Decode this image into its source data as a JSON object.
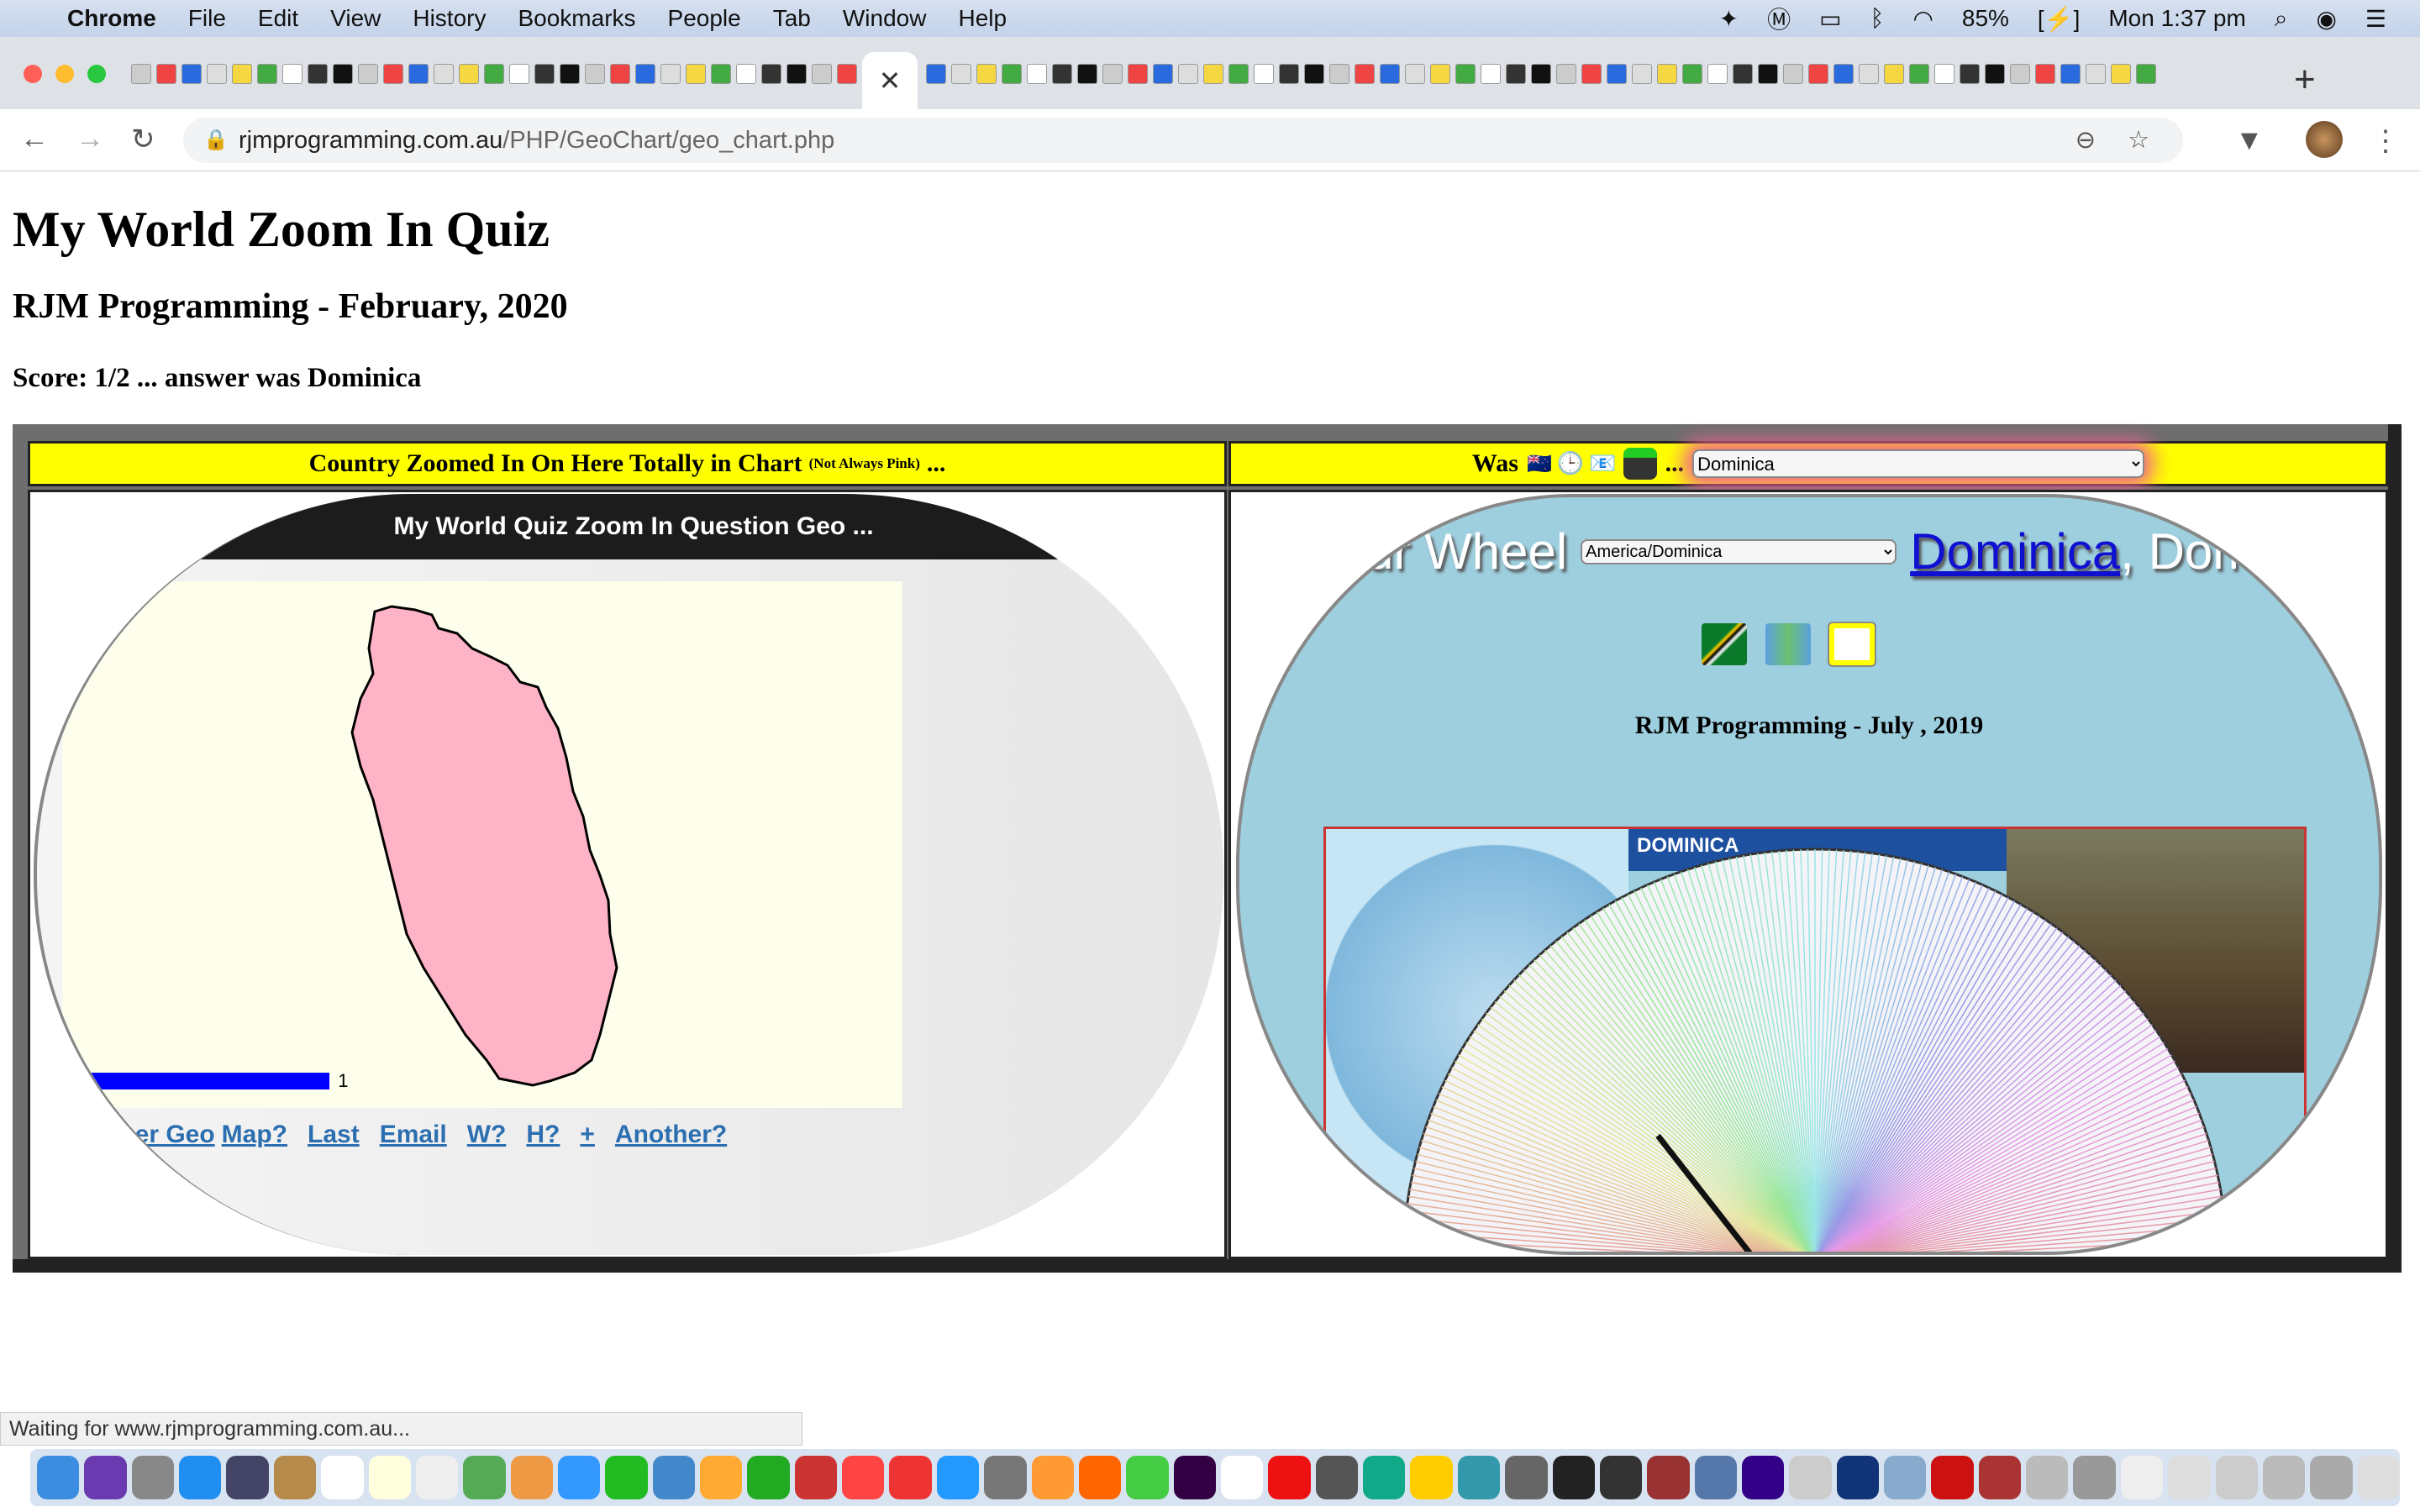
{
  "menubar": {
    "app": "Chrome",
    "items": [
      "File",
      "Edit",
      "View",
      "History",
      "Bookmarks",
      "People",
      "Tab",
      "Window",
      "Help"
    ],
    "battery": "85%",
    "clock": "Mon 1:37 pm"
  },
  "browser": {
    "url_host": "rjmprogramming.com.au",
    "url_path": "/PHP/GeoChart/geo_chart.php",
    "close_tab": "✕",
    "new_tab": "+"
  },
  "page": {
    "title": "My World Zoom In Quiz",
    "subtitle": "RJM Programming - February, 2020",
    "score": "Score: 1/2 ... answer was Dominica",
    "left_header": {
      "main": "Country Zoomed In On Here Totally in Chart",
      "small": "(Not Always Pink)",
      "tail": "..."
    },
    "right_header": {
      "was": "Was",
      "ellipsis": "...",
      "selected": "Dominica"
    },
    "left_panel": {
      "heading": "My World Quiz Zoom In Question Geo ...",
      "legend_min": "1",
      "legend_max": "1",
      "country_color": "#ffb3c6",
      "legend_color": "#0000ff",
      "links": [
        "Another Geo",
        "Map?",
        "Last",
        "Email",
        "W?",
        "H?",
        "+",
        "Another?"
      ]
    },
    "right_panel": {
      "title_prefix": "olour Wheel",
      "timezone": "America/Dominica",
      "country_link": "Dominica",
      "title_suffix": ", Dominic",
      "credit": "RJM Programming - July , 2019",
      "photo_label": "DOMINICA",
      "background": "#9ecfdf"
    }
  },
  "status": "Waiting for www.rjmprogramming.com.au..."
}
